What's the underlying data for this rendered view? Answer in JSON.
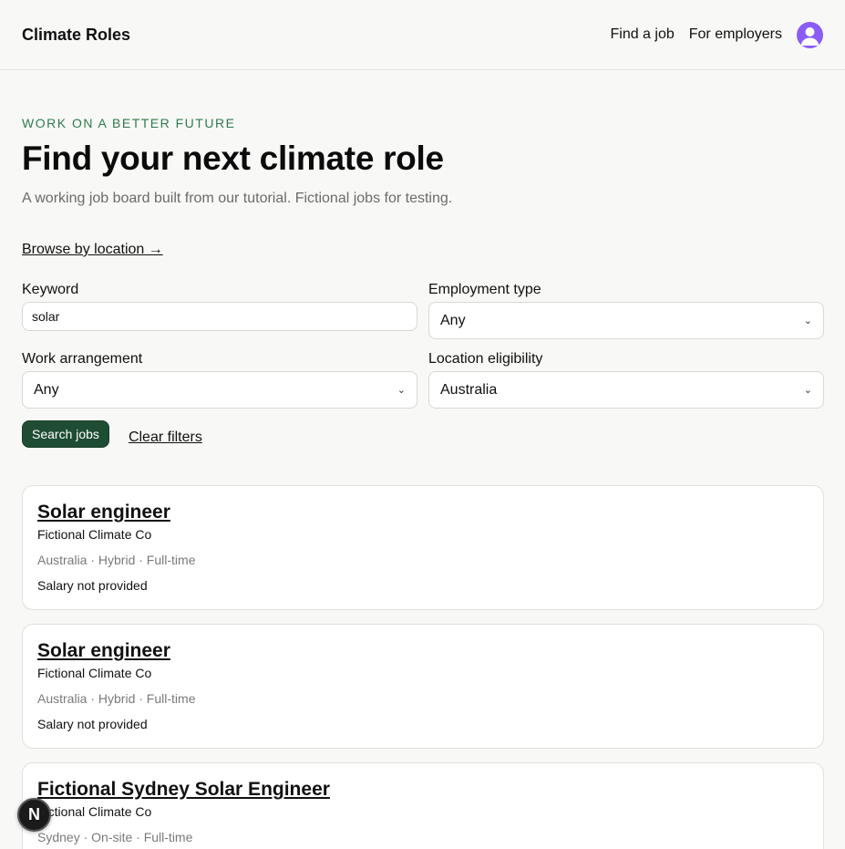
{
  "header": {
    "brand": "Climate Roles",
    "nav": [
      "Find a job",
      "For employers"
    ],
    "avatar_icon": "user-avatar-icon",
    "avatar_color": "#8b5cf6"
  },
  "hero": {
    "eyebrow": "WORK ON A BETTER FUTURE",
    "title": "Find your next climate role",
    "subtitle": "A working job board built from our tutorial. Fictional jobs for testing.",
    "browse_link": "Browse by location →"
  },
  "filters": {
    "keyword": {
      "label": "Keyword",
      "value": "solar"
    },
    "employment_type": {
      "label": "Employment type",
      "value": "Any"
    },
    "work_arrangement": {
      "label": "Work arrangement",
      "value": "Any"
    },
    "location_eligibility": {
      "label": "Location eligibility",
      "value": "Australia"
    },
    "search_button": "Search jobs",
    "clear_link": "Clear filters"
  },
  "jobs": [
    {
      "title": "Solar engineer",
      "company": "Fictional Climate Co",
      "meta": "Australia · Hybrid · Full-time",
      "salary": "Salary not provided"
    },
    {
      "title": "Solar engineer",
      "company": "Fictional Climate Co",
      "meta": "Australia · Hybrid · Full-time",
      "salary": "Salary not provided"
    },
    {
      "title": "Fictional Sydney Solar Engineer",
      "company": "Fictional Climate Co",
      "meta": "Sydney · On-site · Full-time",
      "salary": ""
    }
  ],
  "dev_badge": {
    "letter": "N",
    "icon": "nextjs-dev-indicator-icon"
  },
  "colors": {
    "accent_green": "#2f7a4d",
    "button_green": "#1f4d33",
    "background": "#f8f8f6"
  }
}
